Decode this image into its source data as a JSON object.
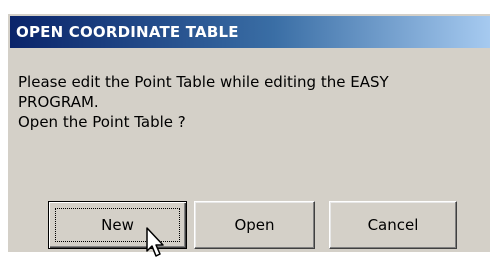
{
  "dialog": {
    "title": "OPEN COORDINATE TABLE",
    "message_lines": [
      "Please edit the Point Table while editing the EASY",
      "PROGRAM.",
      "Open the Point Table ?"
    ],
    "buttons": {
      "new_label": "New",
      "open_label": "Open",
      "cancel_label": "Cancel"
    }
  },
  "colors": {
    "title_gradient_start": "#0a246a",
    "title_gradient_end": "#a6caf0",
    "dialog_background": "#d4d0c8"
  },
  "icons": {
    "cursor": "mouse-pointer-icon"
  }
}
